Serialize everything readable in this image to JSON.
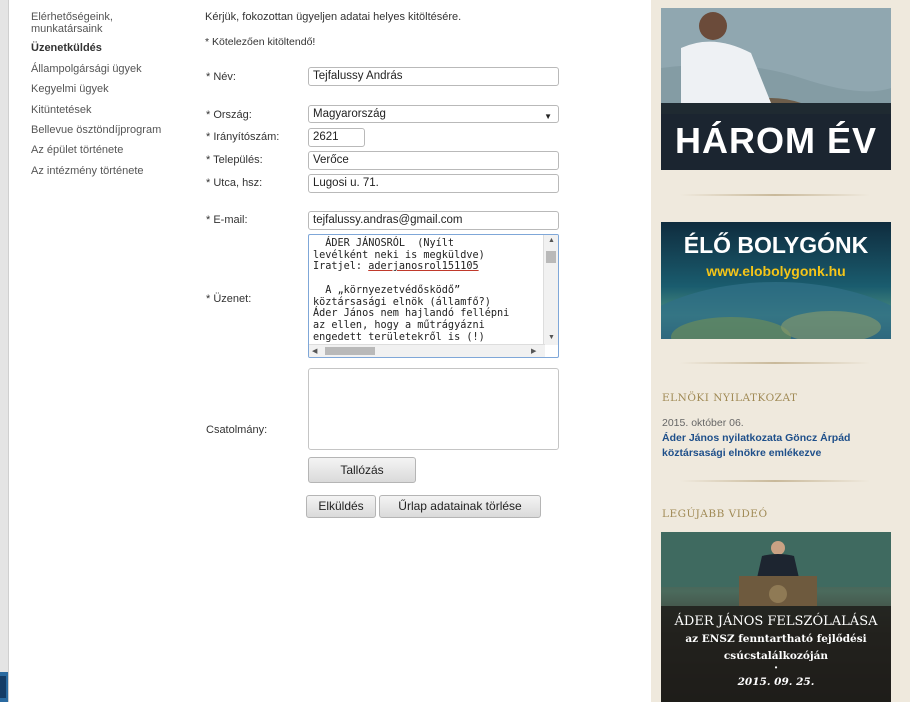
{
  "sidebar": {
    "items": [
      {
        "label": "Elérhetőségeink,"
      },
      {
        "label": "munkatársaink"
      },
      {
        "label": "Üzenetküldés"
      },
      {
        "label": "Állampolgársági ügyek"
      },
      {
        "label": "Kegyelmi ügyek"
      },
      {
        "label": "Kitüntetések"
      },
      {
        "label": "Bellevue ösztöndíjprogram"
      },
      {
        "label": "Az épület története"
      },
      {
        "label": "Az intézmény története"
      }
    ]
  },
  "form": {
    "intro": "Kérjük, fokozottan ügyeljen adatai helyes kitöltésére.",
    "required_note": "* Kötelezően kitöltendő!",
    "fields": {
      "name": {
        "label": "* Név:",
        "value": "Tejfalussy András"
      },
      "country": {
        "label": "* Ország:",
        "value": "Magyarország"
      },
      "zip": {
        "label": "* Irányítószám:",
        "value": "2621"
      },
      "city": {
        "label": "* Település:",
        "value": "Verőce"
      },
      "street": {
        "label": "* Utca, hsz:",
        "value": "Lugosi u. 71."
      },
      "email": {
        "label": "* E-mail:",
        "value": "tejfalussy.andras@gmail.com"
      },
      "message": {
        "label": "* Üzenet:",
        "lines": [
          "  ÁDER JÁNOSRÓL  (Nyílt",
          "levélként neki is megküldve)",
          "Iratjel: ",
          "",
          "  A „környezetvédősködő”",
          "köztársasági elnök (államfő?)",
          "Áder János nem hajlandó fellépni",
          "az ellen, hogy a műtrágyázni",
          "engedett területekről is (!)"
        ],
        "iratjel": "aderjanosrol151105"
      },
      "attachment": {
        "label": "Csatolmány:"
      }
    },
    "browse_label": "Tallózás",
    "submit_label": "Elküldés",
    "clear_label": "Űrlap adatainak törlése"
  },
  "right": {
    "banner1_title": "HÁROM ÉV",
    "banner2_title": "ÉLŐ BOLYGÓNK",
    "banner2_url": "www.elobolygonk.hu",
    "statement_section": "ELNÖKI NYILATKOZAT",
    "statement_date": "2015. október 06.",
    "statement_link": "Áder János nyilatkozata Göncz Árpád köztársasági elnökre emlékezve",
    "video_section": "LEGÚJABB VIDEÓ",
    "video_title": "ÁDER JÁNOS FELSZÓLALÁSA",
    "video_sub1": "az ENSZ fenntartható fejlődési",
    "video_sub2": "csúcstalálkozóján",
    "video_dot": "•",
    "video_date": "2015. 09. 25."
  },
  "colors": {
    "link_blue": "#1e4f8a",
    "section_gold": "#a08a55",
    "right_bg": "#efe9dd"
  }
}
